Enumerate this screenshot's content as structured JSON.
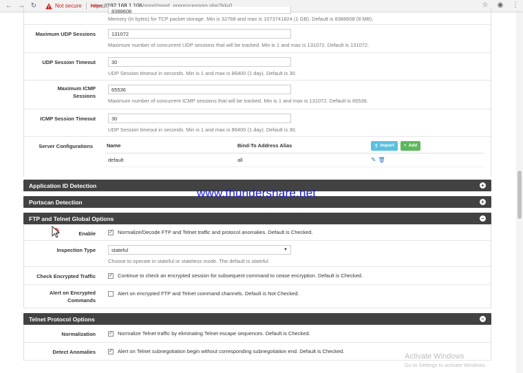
{
  "browser": {
    "security_label": "Not secure",
    "url_scheme": "https",
    "url_host": "://192.168.1.106",
    "url_path": "/snort/snort_preprocessors.php?id=0"
  },
  "top_fields": [
    {
      "label": "",
      "value": "8388608",
      "help": "Memory (in bytes) for TCP packet storage. Min is 32768 and max is 1073741824 (1 GB). Default is 8388608 (8 MB)."
    },
    {
      "label": "Maximum UDP Sessions",
      "value": "131072",
      "help": "Maximum number of concurrent UDP sessions that will be tracked. Min is 1 and max is 131072. Default is 131072."
    },
    {
      "label": "UDP Session Timeout",
      "value": "30",
      "help": "UDP Session timeout in seconds. Min is 1 and max is 86400 (1 day). Default is 30."
    },
    {
      "label": "Maximum ICMP Sessions",
      "value": "65536",
      "help": "Maximum number of concurrent ICMP sessions that will be tracked. Min is 1 and max is 131072. Default is 65536."
    },
    {
      "label": "ICMP Session Timeout",
      "value": "30",
      "help": "UDP Session timeout in seconds. Min is 1 and max is 86400 (1 day). Default is 30."
    }
  ],
  "server_config": {
    "label": "Server Configurations",
    "col_name": "Name",
    "col_alias": "Bind-To Address Alias",
    "import_label": "Import",
    "add_label": "Add",
    "rows": [
      {
        "name": "default",
        "alias": "all"
      }
    ]
  },
  "sections": {
    "app_id": "Application ID Detection",
    "portscan": "Portscan Detection",
    "ftp": "FTP and Telnet Global Options",
    "telnet": "Telnet Protocol Options"
  },
  "ftp_options": {
    "enable_label": "Enable",
    "enable_text": "Normalize/Decode FTP and Telnet traffic and protocol anomalies. Default is Checked.",
    "inspection_label": "Inspection Type",
    "inspection_value": "stateful",
    "inspection_help_prefix": "Choose to operate in stateful or stateless mode. The default is ",
    "inspection_help_em": "stateful",
    "inspection_help_suffix": ".",
    "encrypted_label": "Check Encrypted Traffic",
    "encrypted_text": "Continue to check an encrypted session for subsequent command to cease encryption. Default is Checked.",
    "alert_label": "Alert on Encrypted Commands",
    "alert_text": "Alert on encrypted FTP and Telnet command channels. Default is Not Checked."
  },
  "telnet_options": {
    "normalization_label": "Normalization",
    "normalization_text": "Normalize Telnet traffic by eliminating Telnet escape sequences. Default is Checked.",
    "anomalies_label": "Detect Anomalies",
    "anomalies_text": "Alert on Telnet subnegotiation begin without corresponding subnegotiation end. Default is Checked."
  },
  "overlays": {
    "watermark": "www.thundershare.net",
    "activate_title": "Activate Windows",
    "activate_sub": "Go to Settings to activate Windows."
  },
  "colors": {
    "section_header": "#424242",
    "import_btn": "#5bc0de",
    "add_btn": "#5cb85c",
    "not_secure": "#c5221f"
  }
}
